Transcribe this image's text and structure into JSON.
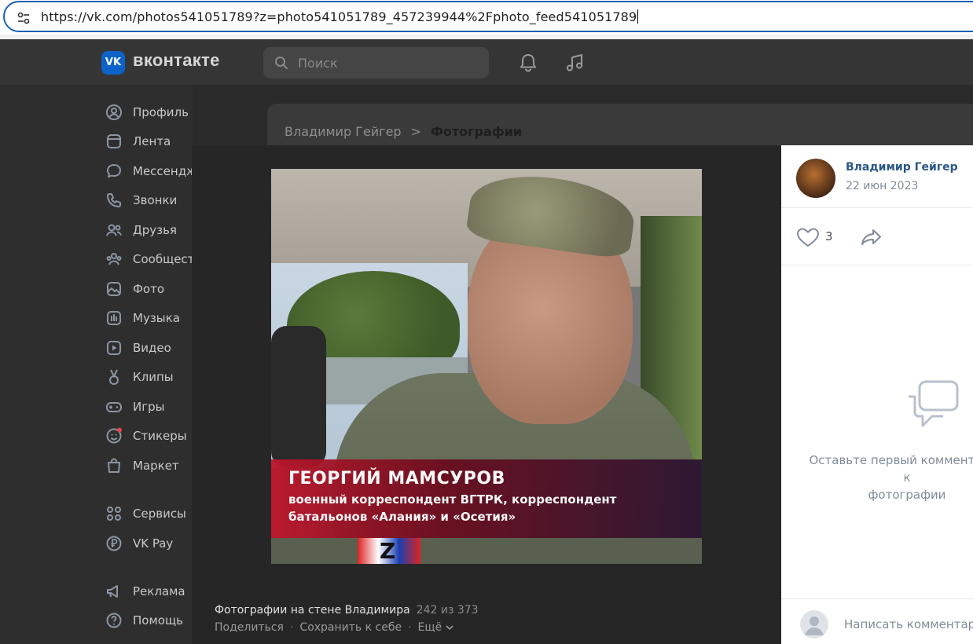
{
  "browser": {
    "url": "https://vk.com/photos541051789?z=photo541051789_457239944%2Fphoto_feed541051789"
  },
  "header": {
    "logo_mark": "VK",
    "logo_text": "вконтакте",
    "search_placeholder": "Поиск",
    "icons": [
      "bell-icon",
      "music-icon"
    ]
  },
  "sidebar": {
    "items": [
      {
        "label": "Профиль",
        "icon": "profile-icon"
      },
      {
        "label": "Лента",
        "icon": "feed-icon"
      },
      {
        "label": "Мессенджер",
        "icon": "messenger-icon"
      },
      {
        "label": "Звонки",
        "icon": "phone-icon"
      },
      {
        "label": "Друзья",
        "icon": "friends-icon"
      },
      {
        "label": "Сообщества",
        "icon": "communities-icon"
      },
      {
        "label": "Фото",
        "icon": "photo-icon"
      },
      {
        "label": "Музыка",
        "icon": "music-icon"
      },
      {
        "label": "Видео",
        "icon": "video-icon"
      },
      {
        "label": "Клипы",
        "icon": "clips-icon"
      },
      {
        "label": "Игры",
        "icon": "games-icon"
      },
      {
        "label": "Стикеры",
        "icon": "stickers-icon"
      },
      {
        "label": "Маркет",
        "icon": "market-icon"
      },
      {
        "label": "Сервисы",
        "icon": "services-icon"
      },
      {
        "label": "VK Pay",
        "icon": "vkpay-icon"
      },
      {
        "label": "Реклама",
        "icon": "ads-icon"
      },
      {
        "label": "Помощь",
        "icon": "help-icon"
      }
    ]
  },
  "breadcrumb": {
    "link": "Владимир Гейгер",
    "separator": ">",
    "current": "Фотографии"
  },
  "photo": {
    "caption_name": "ГЕОРГИЙ МАМСУРОВ",
    "caption_line1": "военный корреспондент ВГТРК, корреспондент",
    "caption_line2": "батальонов «Алания» и «Осетия»",
    "patch_letter": "Z"
  },
  "viewer": {
    "album_title": "Фотографии на стене Владимира",
    "counter": "242 из 373",
    "share": "Поделиться",
    "save": "Сохранить к себе",
    "more": "Ещё",
    "dot": "·"
  },
  "info_panel": {
    "author": "Владимир Гейгер",
    "date": "22 июн 2023",
    "likes": "3",
    "empty_comments_line1": "Оставьте первый комментарий к",
    "empty_comments_line2": "фотографии",
    "comment_placeholder": "Написать комментарий..."
  },
  "colors": {
    "accent": "#2a5885",
    "logo_blue": "#0b63c9",
    "url_border": "#1a5fb4",
    "lower_third_red": "#c0162b"
  }
}
